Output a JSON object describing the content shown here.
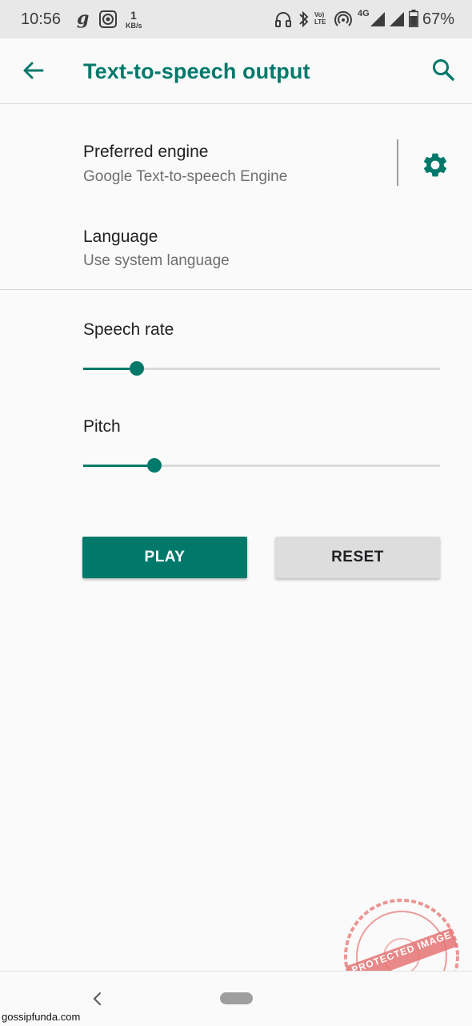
{
  "status_bar": {
    "time": "10:56",
    "net_speed_value": "1",
    "net_speed_unit": "KB/s",
    "volte_label": "Vo) LTE",
    "network_type": "4G",
    "battery_percent": "67%"
  },
  "app_bar": {
    "title": "Text-to-speech output",
    "back_icon": "arrow-left-icon",
    "search_icon": "search-icon"
  },
  "preferred_engine": {
    "title": "Preferred engine",
    "value": "Google Text-to-speech Engine",
    "settings_icon": "gear-icon"
  },
  "language": {
    "title": "Language",
    "value": "Use system language"
  },
  "speech_rate": {
    "label": "Speech rate",
    "level": 0.15
  },
  "pitch": {
    "label": "Pitch",
    "level": 0.2
  },
  "buttons": {
    "play": "PLAY",
    "reset": "RESET"
  },
  "footer": {
    "watermark": "gossipfunda.com"
  },
  "stamp": {
    "text": "PROTECTED IMAGE"
  },
  "colors": {
    "accent": "#00796b",
    "background": "#fafafa",
    "status_bar": "#e8e8e8",
    "reset_button": "#dddddd"
  }
}
